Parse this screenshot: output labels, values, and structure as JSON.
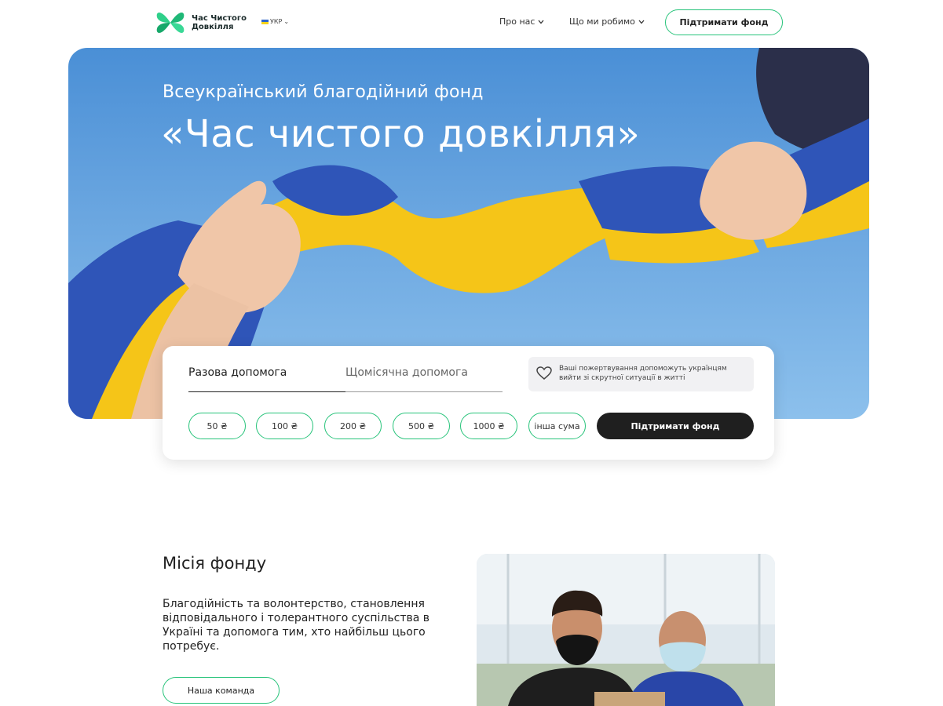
{
  "header": {
    "logo_text": "Час Чистого Довкілля",
    "lang": "УКР",
    "nav": [
      {
        "label": "Про нас"
      },
      {
        "label": "Що ми робимо"
      }
    ],
    "cta_label": "Підтримати фонд"
  },
  "hero": {
    "subtitle": "Всеукраїнський благодійний фонд",
    "title": "«Час чистого довкілля»"
  },
  "donate": {
    "tabs": [
      "Разова допомога",
      "Щомісячна допомога"
    ],
    "active_tab": 0,
    "info": "Ваші пожертвування допоможуть українцям вийти зі скрутної ситуації в житті",
    "amounts": [
      "50 ₴",
      "100 ₴",
      "200 ₴",
      "500 ₴",
      "1000 ₴",
      "інша сума"
    ],
    "submit_label": "Підтримати фонд"
  },
  "mission": {
    "title": "Місія фонду",
    "text": "Благодійність та волонтерство, становлення відповідального і толерантного суспільства в Україні та допомога тим, хто найбільш цього потребує.",
    "button_label": "Наша команда"
  },
  "colors": {
    "accent": "#27c37a",
    "dark_button": "#1f1f1f",
    "flag_blue": "#2f55b8",
    "flag_yellow": "#f5c518"
  }
}
